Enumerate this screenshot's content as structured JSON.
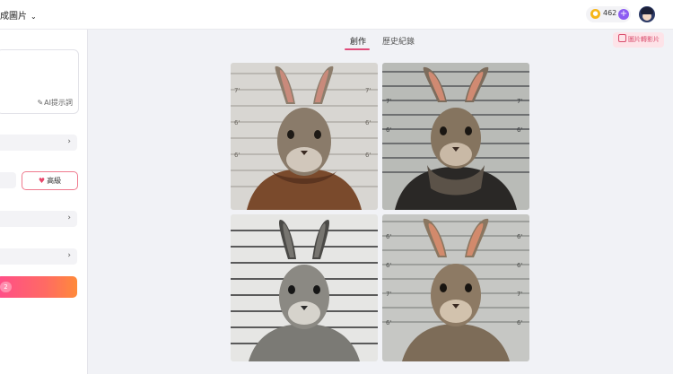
{
  "header": {
    "app_title": "成圖片",
    "coin_count": "462",
    "coin_icon": "coin-icon",
    "add_icon": "plus-icon",
    "avatar_icon": "user-avatar"
  },
  "sidebar": {
    "ai_prompt_label": "AI提示詞",
    "advanced_label": "高級",
    "generate_badge": "2"
  },
  "tabs": [
    {
      "label": "創作",
      "active": true
    },
    {
      "label": "歷史紀錄",
      "active": false
    }
  ],
  "actions": {
    "image_to_video_label": "圖片轉影片"
  },
  "gallery": {
    "images": [
      {
        "name": "rabbit-mugshot-1",
        "background": "light lineup wall",
        "outfit": "knit scarf"
      },
      {
        "name": "rabbit-mugshot-2",
        "background": "grungy lineup wall",
        "outfit": "scarf and jacket"
      },
      {
        "name": "rabbit-mugshot-3",
        "background": "white lineup wall",
        "outfit": "none"
      },
      {
        "name": "rabbit-mugshot-4",
        "background": "grey lineup wall",
        "outfit": "none"
      }
    ]
  },
  "colors": {
    "accent": "#e04c7a",
    "generate_gradient_start": "#ff4d8a",
    "generate_gradient_end": "#ff8a3a",
    "coin": "#f6b619",
    "plus": "#8c5cf2"
  }
}
